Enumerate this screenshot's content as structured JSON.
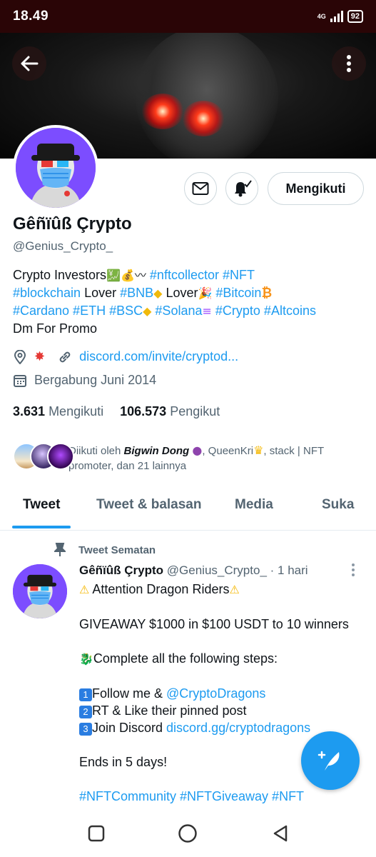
{
  "status_bar": {
    "time": "18.49",
    "network": "4G",
    "battery": "92"
  },
  "profile": {
    "name": "Gêñïûß Çrypto",
    "handle": "@Genius_Crypto_",
    "follow_label": "Mengikuti",
    "bio": {
      "l1a": "Crypto Investors",
      "l1b": "#nftcollector #NFT",
      "l2a": "#blockchain",
      "l2b": " Lover ",
      "l2c": "#BNB",
      "l2d": " Lover",
      "l2e": "#Bitcoin",
      "l3a": "#Cardano #ETH #BSC",
      "l3b": "#Solana",
      "l3c": "#Crypto #Altcoins",
      "l4": "Dm For Promo"
    },
    "link": "discord.com/invite/cryptod...",
    "joined": "Bergabung Juni 2014",
    "following_count": "3.631",
    "following_label": "Mengikuti",
    "followers_count": "106.573",
    "followers_label": "Pengikut",
    "followed_by": {
      "prefix": "Diikuti oleh",
      "name1": "Bigwin Dong",
      "middle": ", QueenKri",
      "rest": ", stack | NFT promoter, dan 21 lainnya"
    }
  },
  "tabs": [
    "Tweet",
    "Tweet & balasan",
    "Media",
    "Suka"
  ],
  "pinned_label": "Tweet Sematan",
  "tweet": {
    "name": "Gêñïûß Çrypto",
    "handle": "@Genius_Crypto_",
    "time": " · 1 hari",
    "line1": " Attention Dragon Riders",
    "line2": "GIVEAWAY $1000 in $100 USDT to 10 winners",
    "line3": "Complete all the following steps:",
    "step1": "Follow me & ",
    "step1_link": "@CryptoDragons",
    "step2": "RT & Like their pinned post",
    "step3": "Join Discord ",
    "step3_link": "discord.gg/cryptodragons",
    "line4": "Ends in 5 days!",
    "hashtags": "#NFTCommunity #NFTGiveaway #NFT"
  },
  "colors": {
    "accent": "#1d9bf0",
    "status_bar": "#2a0506",
    "text": "#0f1419",
    "muted": "#536471"
  }
}
